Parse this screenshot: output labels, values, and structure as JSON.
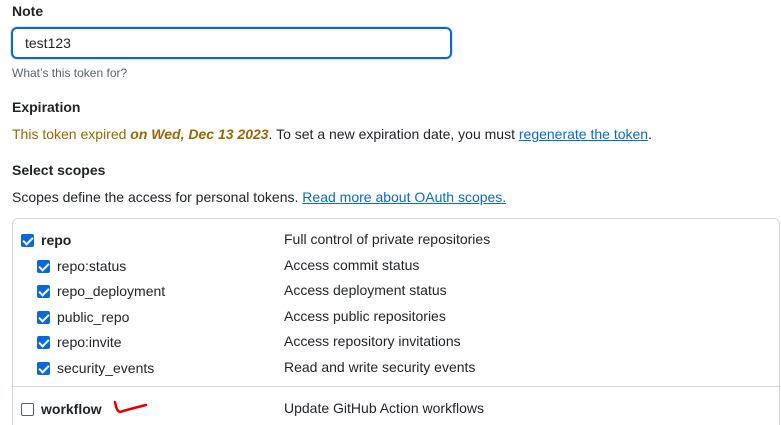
{
  "note": {
    "heading": "Note",
    "value": "test123",
    "hint": "What’s this token for?"
  },
  "expiration": {
    "heading": "Expiration",
    "msg_prefix": "This token expired",
    "msg_date": "on Wed, Dec 13 2023",
    "msg_mid": ". To set a new expiration date, you must",
    "msg_link": "regenerate the token",
    "msg_suffix": "."
  },
  "scopes": {
    "heading": "Select scopes",
    "desc_text": "Scopes define the access for personal tokens.",
    "desc_link": "Read more about OAuth scopes.",
    "items": [
      {
        "name": "repo",
        "desc": "Full control of private repositories",
        "checked": true
      },
      {
        "name": "repo:status",
        "desc": "Access commit status",
        "checked": true
      },
      {
        "name": "repo_deployment",
        "desc": "Access deployment status",
        "checked": true
      },
      {
        "name": "public_repo",
        "desc": "Access public repositories",
        "checked": true
      },
      {
        "name": "repo:invite",
        "desc": "Access repository invitations",
        "checked": true
      },
      {
        "name": "security_events",
        "desc": "Read and write security events",
        "checked": true
      },
      {
        "name": "workflow",
        "desc": "Update GitHub Action workflows",
        "checked": false
      }
    ]
  },
  "colors": {
    "accent": "#0969da",
    "warning": "#9a6700",
    "annotation": "#e00000"
  }
}
